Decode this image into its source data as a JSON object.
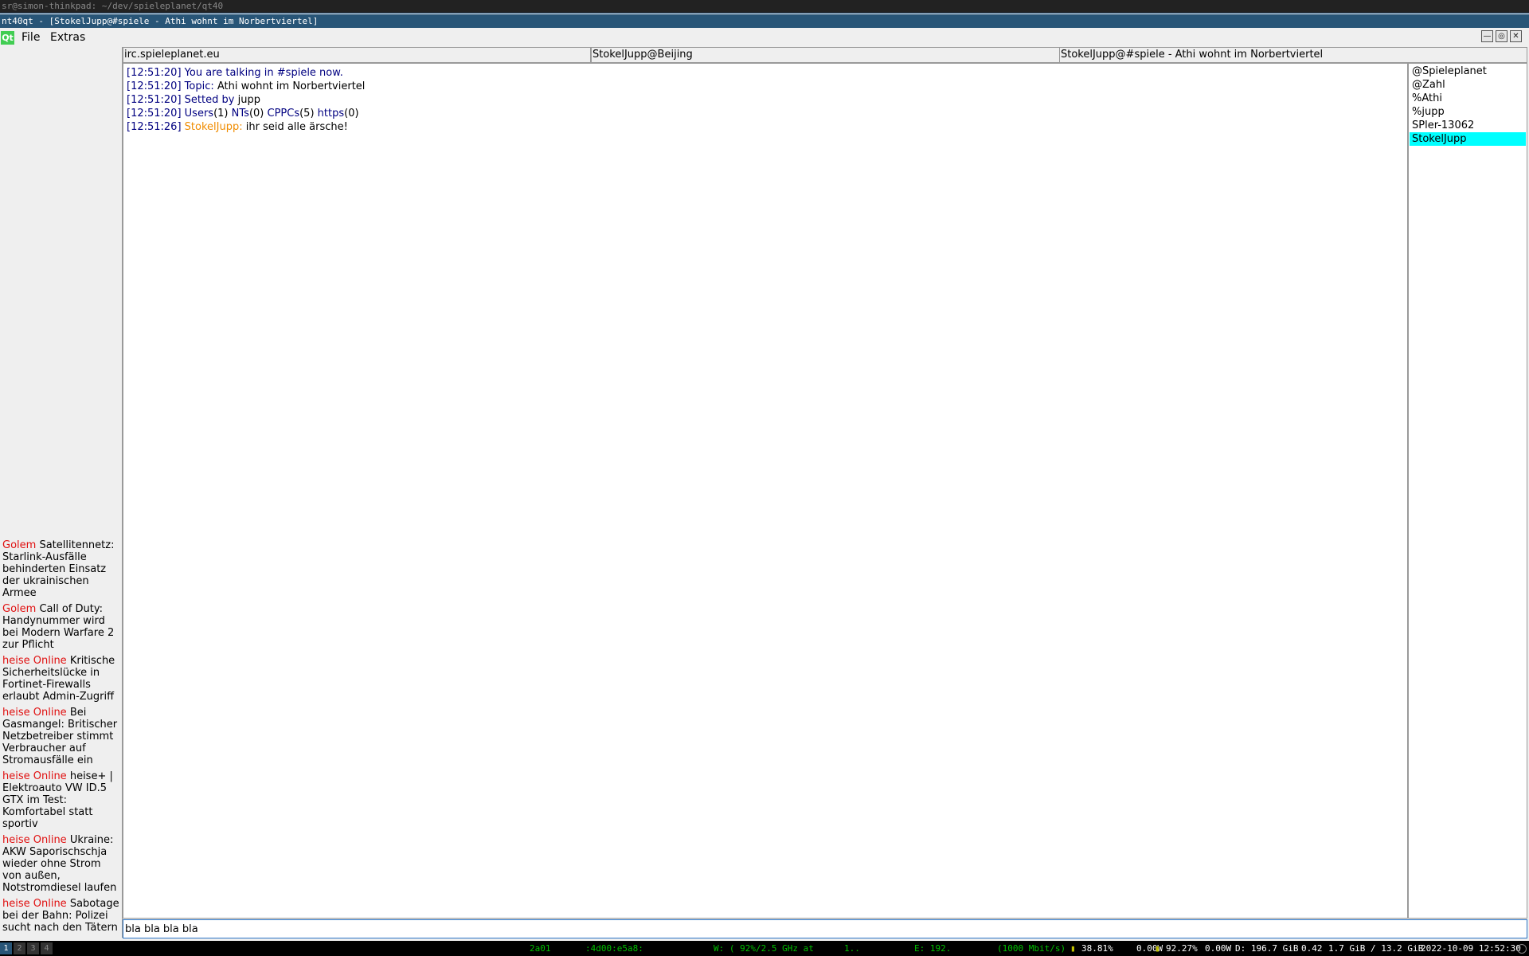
{
  "terminal_title": "sr@simon-thinkpad: ~/dev/spieleplanet/qt40",
  "window_title": "nt40qt - [StokelJupp@#spiele - Athi wohnt im Norbertviertel]",
  "menu": {
    "logo": "Qt",
    "file": "File",
    "extras": "Extras"
  },
  "window_buttons": {
    "minimize": "—",
    "restore": "◎",
    "close": "✕"
  },
  "tabs": [
    {
      "label": "irc.spieleplanet.eu"
    },
    {
      "label": "StokelJupp@Beijing"
    },
    {
      "label": "StokelJupp@#spiele - Athi wohnt im Norbertviertel"
    }
  ],
  "chat": {
    "line1": {
      "ts": "[12:51:20]",
      "text": "You are talking in #spiele now."
    },
    "line2": {
      "ts": "[12:51:20]",
      "label": "Topic:",
      "value": "Athi wohnt im Norbertviertel"
    },
    "line3": {
      "ts": "[12:51:20]",
      "label": "Setted by",
      "value": "jupp"
    },
    "line4": {
      "ts": "[12:51:20]",
      "users_label": "Users",
      "users_val": "(1)",
      "nts_label": "NTs",
      "nts_val": "(0)",
      "cppcs_label": "CPPCs",
      "cppcs_val": "(5)",
      "https_label": "https",
      "https_val": "(0)"
    },
    "line5": {
      "ts": "[12:51:26]",
      "nick": "StokelJupp:",
      "text": "ihr seid alle ärsche!"
    }
  },
  "users": [
    {
      "name": "@Spieleplanet",
      "selected": false
    },
    {
      "name": "@Zahl",
      "selected": false
    },
    {
      "name": "%Athi",
      "selected": false
    },
    {
      "name": "%jupp",
      "selected": false
    },
    {
      "name": "SPler-13062",
      "selected": false
    },
    {
      "name": "StokelJupp",
      "selected": true
    }
  ],
  "news": [
    {
      "source": "Golem",
      "text": "Satellitennetz: Starlink-Ausfälle behinderten Einsatz der ukrainischen Armee"
    },
    {
      "source": "Golem",
      "text": "Call of Duty: Handynummer wird bei Modern Warfare 2 zur Pflicht"
    },
    {
      "source": "heise Online",
      "text": "Kritische Sicherheitslücke in Fortinet-Firewalls erlaubt Admin-Zugriff"
    },
    {
      "source": "heise Online",
      "text": "Bei Gasmangel: Britischer Netzbetreiber stimmt Verbraucher auf Stromausfälle ein"
    },
    {
      "source": "heise Online",
      "text": "heise+ | Elektroauto VW ID.5 GTX im Test: Komfortabel statt sportiv"
    },
    {
      "source": "heise Online",
      "text": "Ukraine: AKW Saporischschja wieder ohne Strom von außen, Notstromdiesel laufen"
    },
    {
      "source": "heise Online",
      "text": "Sabotage bei der Bahn: Polizei sucht nach den Tätern"
    }
  ],
  "input": {
    "value": "bla bla bla bla "
  },
  "statusbar": {
    "workspaces": [
      "1",
      "2",
      "3",
      "4"
    ],
    "ipv6_prefix": "2a01",
    "ipv6_suffix": ":4d00:e5a8:",
    "wifi": "W: ( 92%/2.5 GHz at",
    "wifi_extra": "1..",
    "eth": "E: 192.",
    "eth_speed": "(1000 Mbit/s)",
    "bat1": "38.81%",
    "bat1_power": "0.00W",
    "bat2": "92.27%",
    "bat2_power": "0.00W",
    "disk": "D: 196.7 GiB",
    "load": "0.42",
    "mem": "1.7 GiB / 13.2 GiB",
    "datetime": "2022-10-09 12:52:30"
  },
  "colors": {
    "news_source": "#e01010",
    "chat_system": "#000080",
    "nick": "#f08c00",
    "selection": "#00ffff",
    "status_green": "#00c000"
  }
}
